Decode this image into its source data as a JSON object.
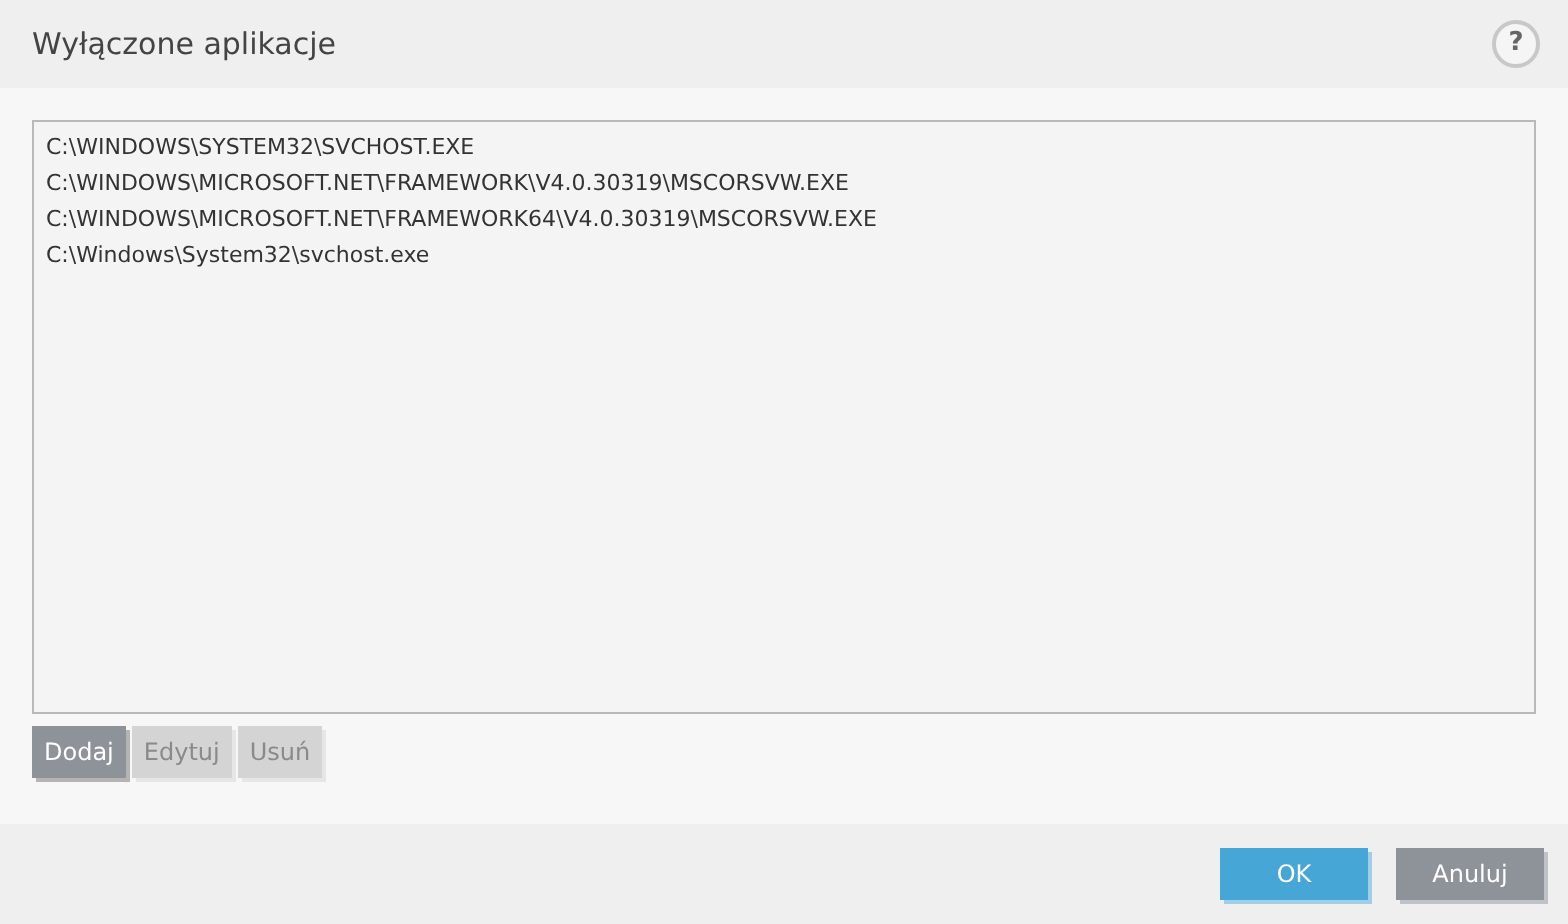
{
  "window": {
    "title": "Wyłączone aplikacje",
    "help": "?"
  },
  "list": {
    "items": [
      "C:\\WINDOWS\\SYSTEM32\\SVCHOST.EXE",
      "C:\\WINDOWS\\MICROSOFT.NET\\FRAMEWORK\\V4.0.30319\\MSCORSVW.EXE",
      "C:\\WINDOWS\\MICROSOFT.NET\\FRAMEWORK64\\V4.0.30319\\MSCORSVW.EXE",
      "C:\\Windows\\System32\\svchost.exe"
    ]
  },
  "list_buttons": [
    {
      "label": "Dodaj",
      "disabled": false
    },
    {
      "label": "Edytuj",
      "disabled": true
    },
    {
      "label": "Usuń",
      "disabled": true
    }
  ],
  "footer_buttons": [
    {
      "label": "OK",
      "kind": "primary"
    },
    {
      "label": "Anuluj",
      "kind": "secondary"
    }
  ]
}
